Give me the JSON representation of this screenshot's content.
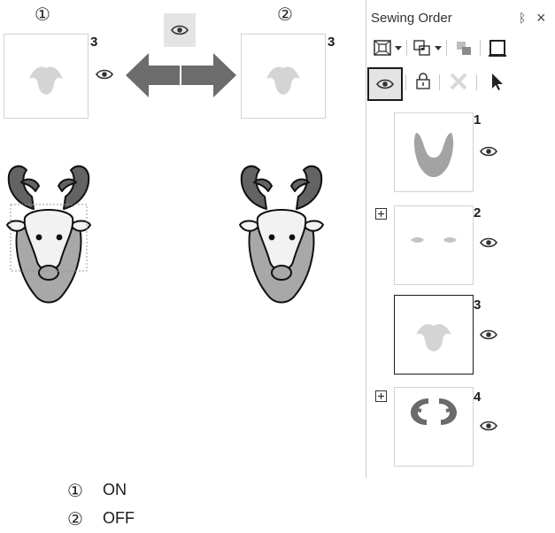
{
  "labels": {
    "marker_on": "①",
    "marker_off": "②",
    "thumb_number_left": "3",
    "thumb_number_right": "3"
  },
  "panel": {
    "title": "Sewing Order",
    "pin_glyph": "ᛒ",
    "close_glyph": "×",
    "items": [
      {
        "number": "1",
        "shape": "v-beard",
        "expander": false,
        "selected": false
      },
      {
        "number": "2",
        "shape": "ears",
        "expander": true,
        "selected": false
      },
      {
        "number": "3",
        "shape": "head-silhouette",
        "expander": false,
        "selected": true
      },
      {
        "number": "4",
        "shape": "antler-ring",
        "expander": true,
        "selected": false
      }
    ]
  },
  "legend": [
    {
      "marker": "①",
      "text": "ON"
    },
    {
      "marker": "②",
      "text": "OFF"
    }
  ],
  "colors": {
    "antler": "#636363",
    "face": "#f2f2f2",
    "beard": "#a8a8a8",
    "thumb_shape": "#d4d4d4",
    "arrow": "#6c6c6c"
  }
}
